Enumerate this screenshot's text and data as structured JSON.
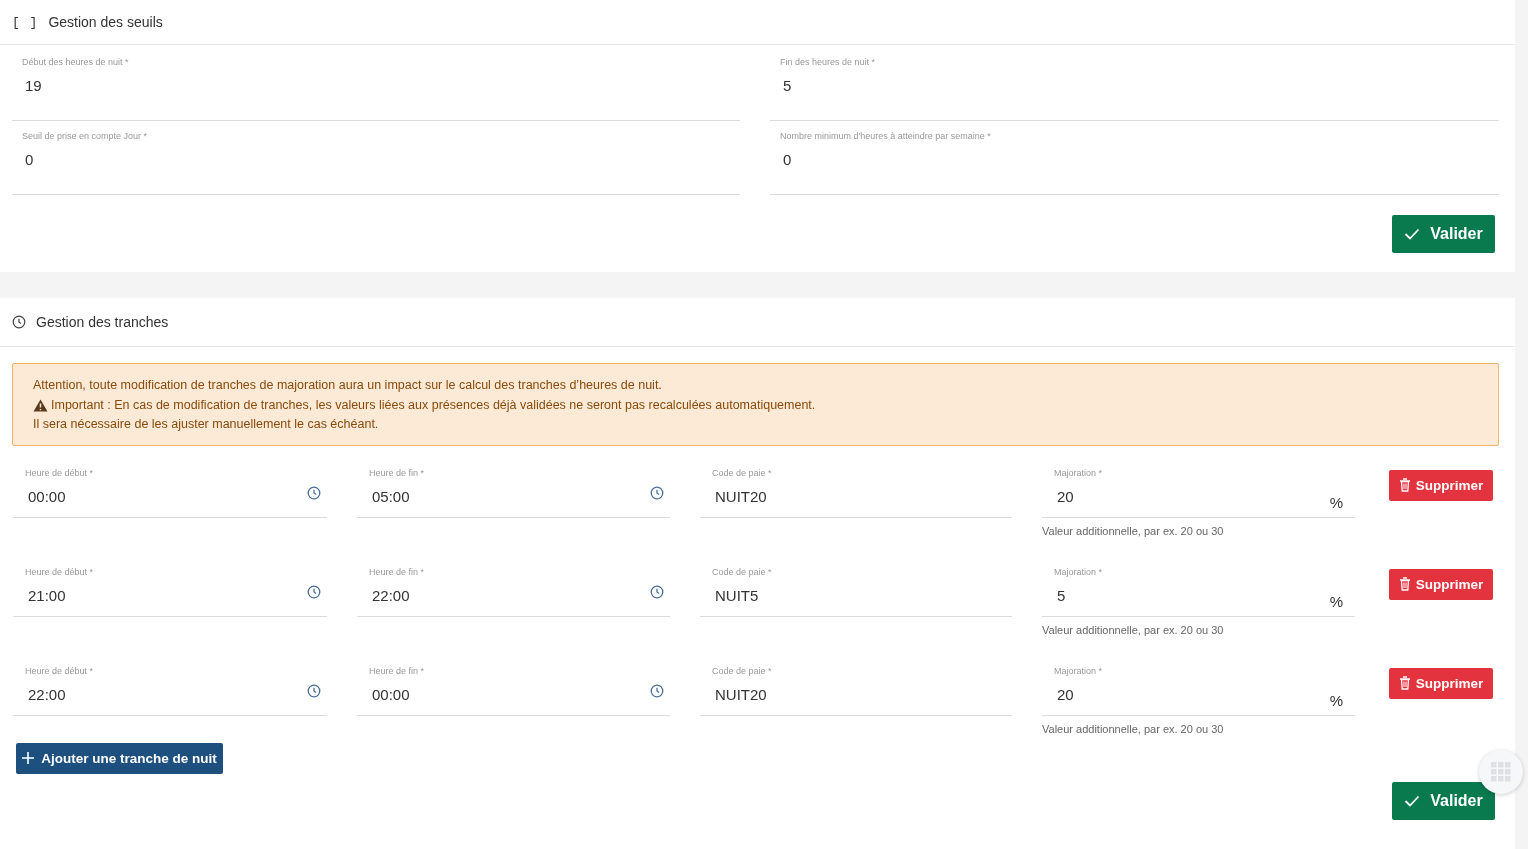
{
  "thresholds": {
    "title_icon": "[ ]",
    "title": "Gestion des seuils",
    "fields": [
      {
        "label": "Début des heures de nuit *",
        "value": "19"
      },
      {
        "label": "Fin des heures de nuit *",
        "value": "5"
      },
      {
        "label": "Seuil de prise en compte Jour *",
        "value": "0"
      },
      {
        "label": "Nombre minimum d'heures à atteindre par semaine *",
        "value": "0"
      }
    ],
    "submit": "Valider"
  },
  "tranches": {
    "title": "Gestion des tranches",
    "alert": {
      "line_1": "Attention, toute modification de tranches de majoration aura un impact sur le calcul des tranches d’heures de nuit.",
      "line_2": "Important : En cas de modification de tranches, les valeurs liées aux présences déjà validées ne seront pas recalculées automatiquement.",
      "line_3": "Il sera nécessaire de les ajuster manuellement le cas échéant."
    },
    "rows": [
      {
        "start_label": "Heure de début *",
        "start": "00:00",
        "end_label": "Heure de fin *",
        "end": "05:00",
        "code_label": "Code de paie *",
        "code": "NUIT20",
        "rate_label": "Majoration *",
        "rate": "20",
        "unit": "%",
        "hint": "Valeur additionnelle, par ex. 20 ou 30",
        "delete": "Supprimer"
      },
      {
        "start_label": "Heure de début *",
        "start": "21:00",
        "end_label": "Heure de fin *",
        "end": "22:00",
        "code_label": "Code de paie *",
        "code": "NUIT5",
        "rate_label": "Majoration *",
        "rate": "5",
        "unit": "%",
        "hint": "Valeur additionnelle, par ex. 20 ou 30",
        "delete": "Supprimer"
      },
      {
        "start_label": "Heure de début *",
        "start": "22:00",
        "end_label": "Heure de fin *",
        "end": "00:00",
        "code_label": "Code de paie *",
        "code": "NUIT20",
        "rate_label": "Majoration *",
        "rate": "20",
        "unit": "%",
        "hint": "Valeur additionnelle, par ex. 20 ou 30",
        "delete": "Supprimer"
      }
    ],
    "add": "Ajouter une tranche de nuit",
    "submit": "Valider"
  }
}
